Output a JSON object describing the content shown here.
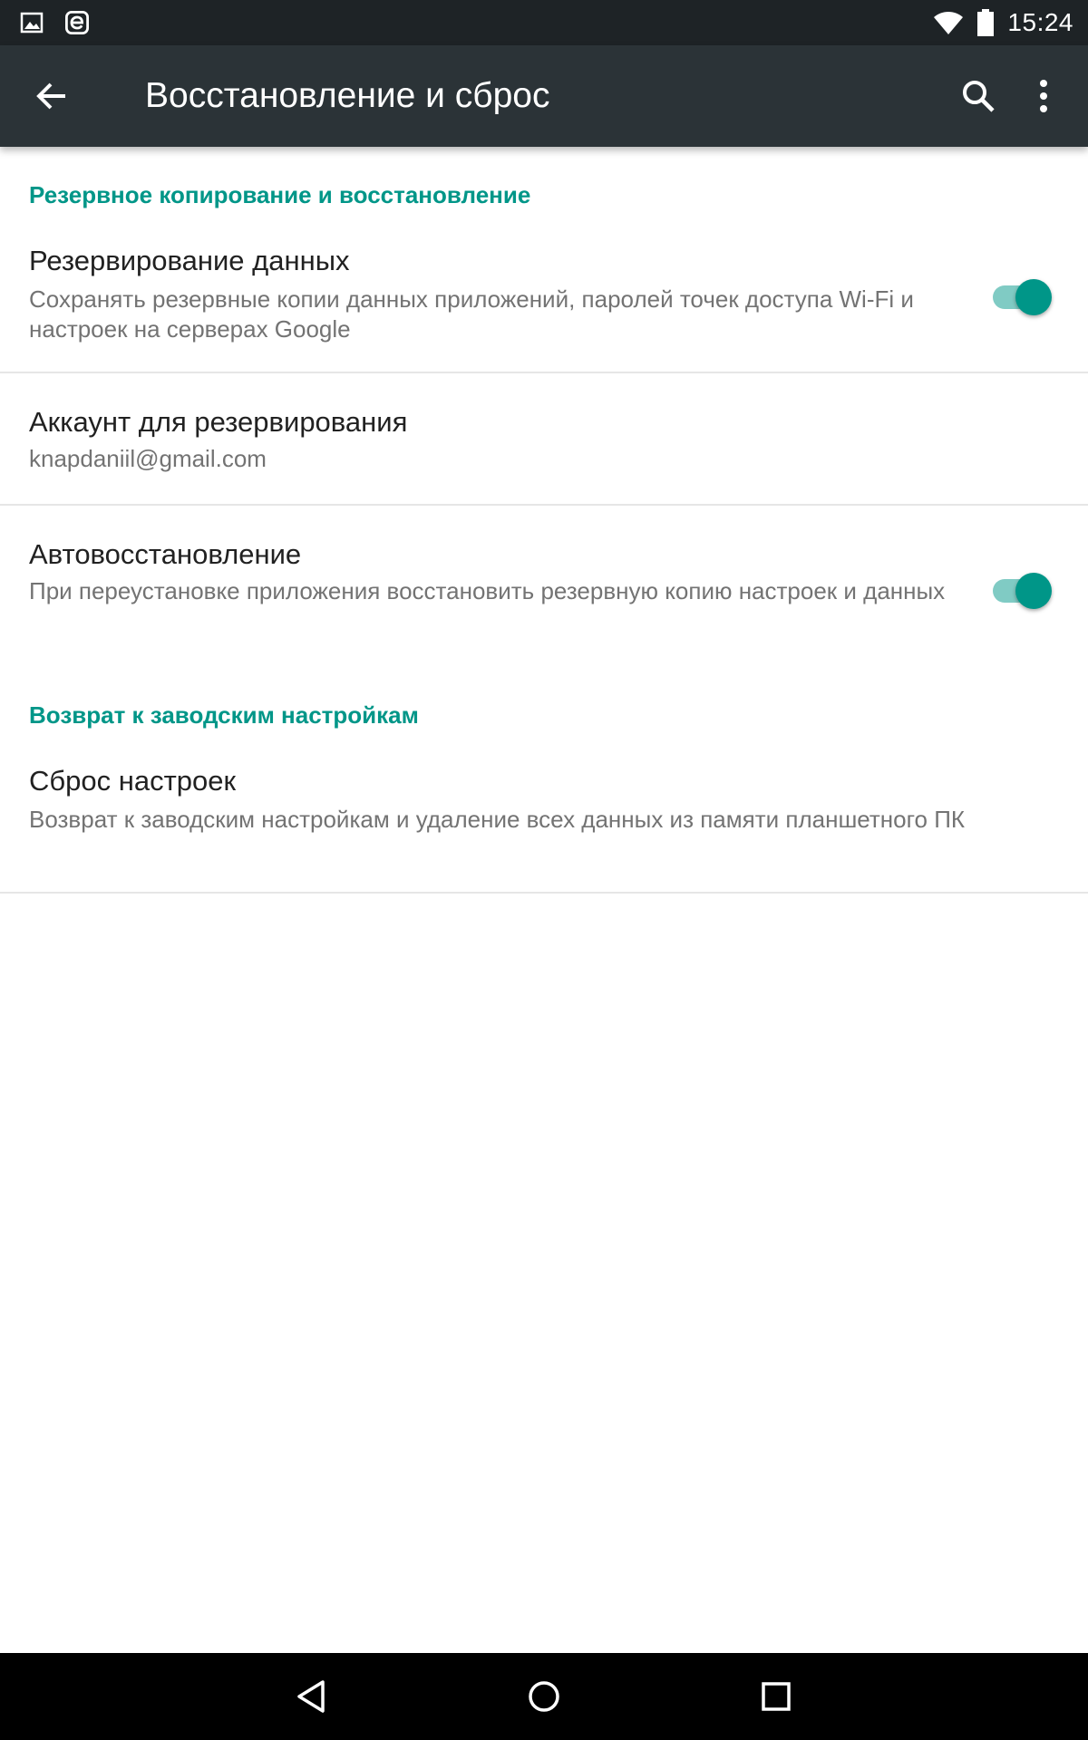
{
  "status_bar": {
    "time": "15:24",
    "left_icons": [
      "image-notification-icon",
      "e-app-notification-icon"
    ],
    "right_icons": [
      "wifi-icon",
      "battery-icon"
    ]
  },
  "toolbar": {
    "title": "Восстановление и сброс",
    "back_icon": "arrow-back-icon",
    "search_icon": "search-icon",
    "more_icon": "more-vert-icon"
  },
  "sections": [
    {
      "header": "Резервное копирование и восстановление",
      "items": [
        {
          "title": "Резервирование данных",
          "summary": "Сохранять резервные копии данных приложений, паролей точек доступа Wi-Fi и настроек на серверах Google",
          "switch_on": true
        },
        {
          "title": "Аккаунт для резервирования",
          "summary": "knapdaniil@gmail.com"
        },
        {
          "title": "Автовосстановление",
          "summary": "При переустановке приложения восстановить резервную копию настроек и данных",
          "switch_on": true
        }
      ]
    },
    {
      "header": "Возврат к заводским настройкам",
      "items": [
        {
          "title": "Сброс настроек",
          "summary": "Возврат к заводским настройкам и удаление всех данных из памяти планшетного ПК"
        }
      ]
    }
  ],
  "colors": {
    "accent": "#009688",
    "switch_track": "#80cbc4",
    "toolbar_bg": "#2b3337",
    "status_bar_bg": "#1e2326",
    "title_text": "#212121",
    "summary_text": "#737373"
  },
  "nav_bar": {
    "icons": [
      "nav-back-icon",
      "nav-home-icon",
      "nav-recents-icon"
    ]
  }
}
